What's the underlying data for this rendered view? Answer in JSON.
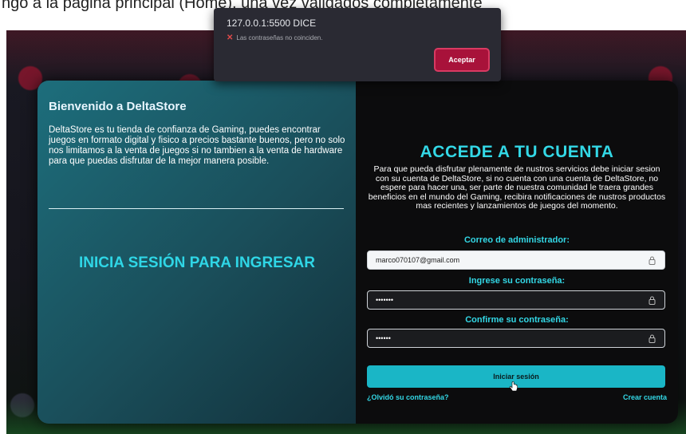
{
  "top_caption": "ngo a la pagina principal (Home), una vez validados completamente",
  "dialog": {
    "title": "127.0.0.1:5500 DICE",
    "message": "Las contraseñas no coinciden.",
    "accept_label": "Aceptar"
  },
  "left_panel": {
    "title": "Bienvenido a DeltaStore",
    "description": "DeltaStore es tu tienda de confianza de Gaming, puedes encontrar juegos en formato digital y fisico a precios bastante buenos, pero no solo nos limitamos a la venta de juegos si no tambien a la venta de hardware para que puedas disfrutar de la mejor manera posible.",
    "cta": "INICIA SESIÓN PARA INGRESAR"
  },
  "right_panel": {
    "title": "ACCEDE A TU CUENTA",
    "description": "Para que pueda disfrutar plenamente de nustros servicios debe iniciar sesion con su cuenta de DeltaStore, si no cuenta con una cuenta de DeltaStore, no espere para hacer una, ser parte de nuestra comunidad le traera grandes beneficios en el mundo del Gaming, recibira notificaciones de nustros productos mas recientes y lanzamientos de juegos del momento.",
    "email_label": "Correo de administrador:",
    "email_value": "marco070107@gmail.com",
    "password_label": "Ingrese su contraseña:",
    "password_value": "•••••••",
    "confirm_label": "Confirme su contraseña:",
    "confirm_value": "••••••",
    "submit_label": "Iniciar sesión",
    "forgot_label": "¿Olvidó su contraseña?",
    "create_label": "Crear cuenta"
  },
  "icons": {
    "lock": "lock-icon",
    "error": "x-icon",
    "cursor": "hand-pointer-icon"
  },
  "colors": {
    "accent": "#33d8e6",
    "button": "#1ab6c6",
    "dialog_button": "#a8123a"
  }
}
